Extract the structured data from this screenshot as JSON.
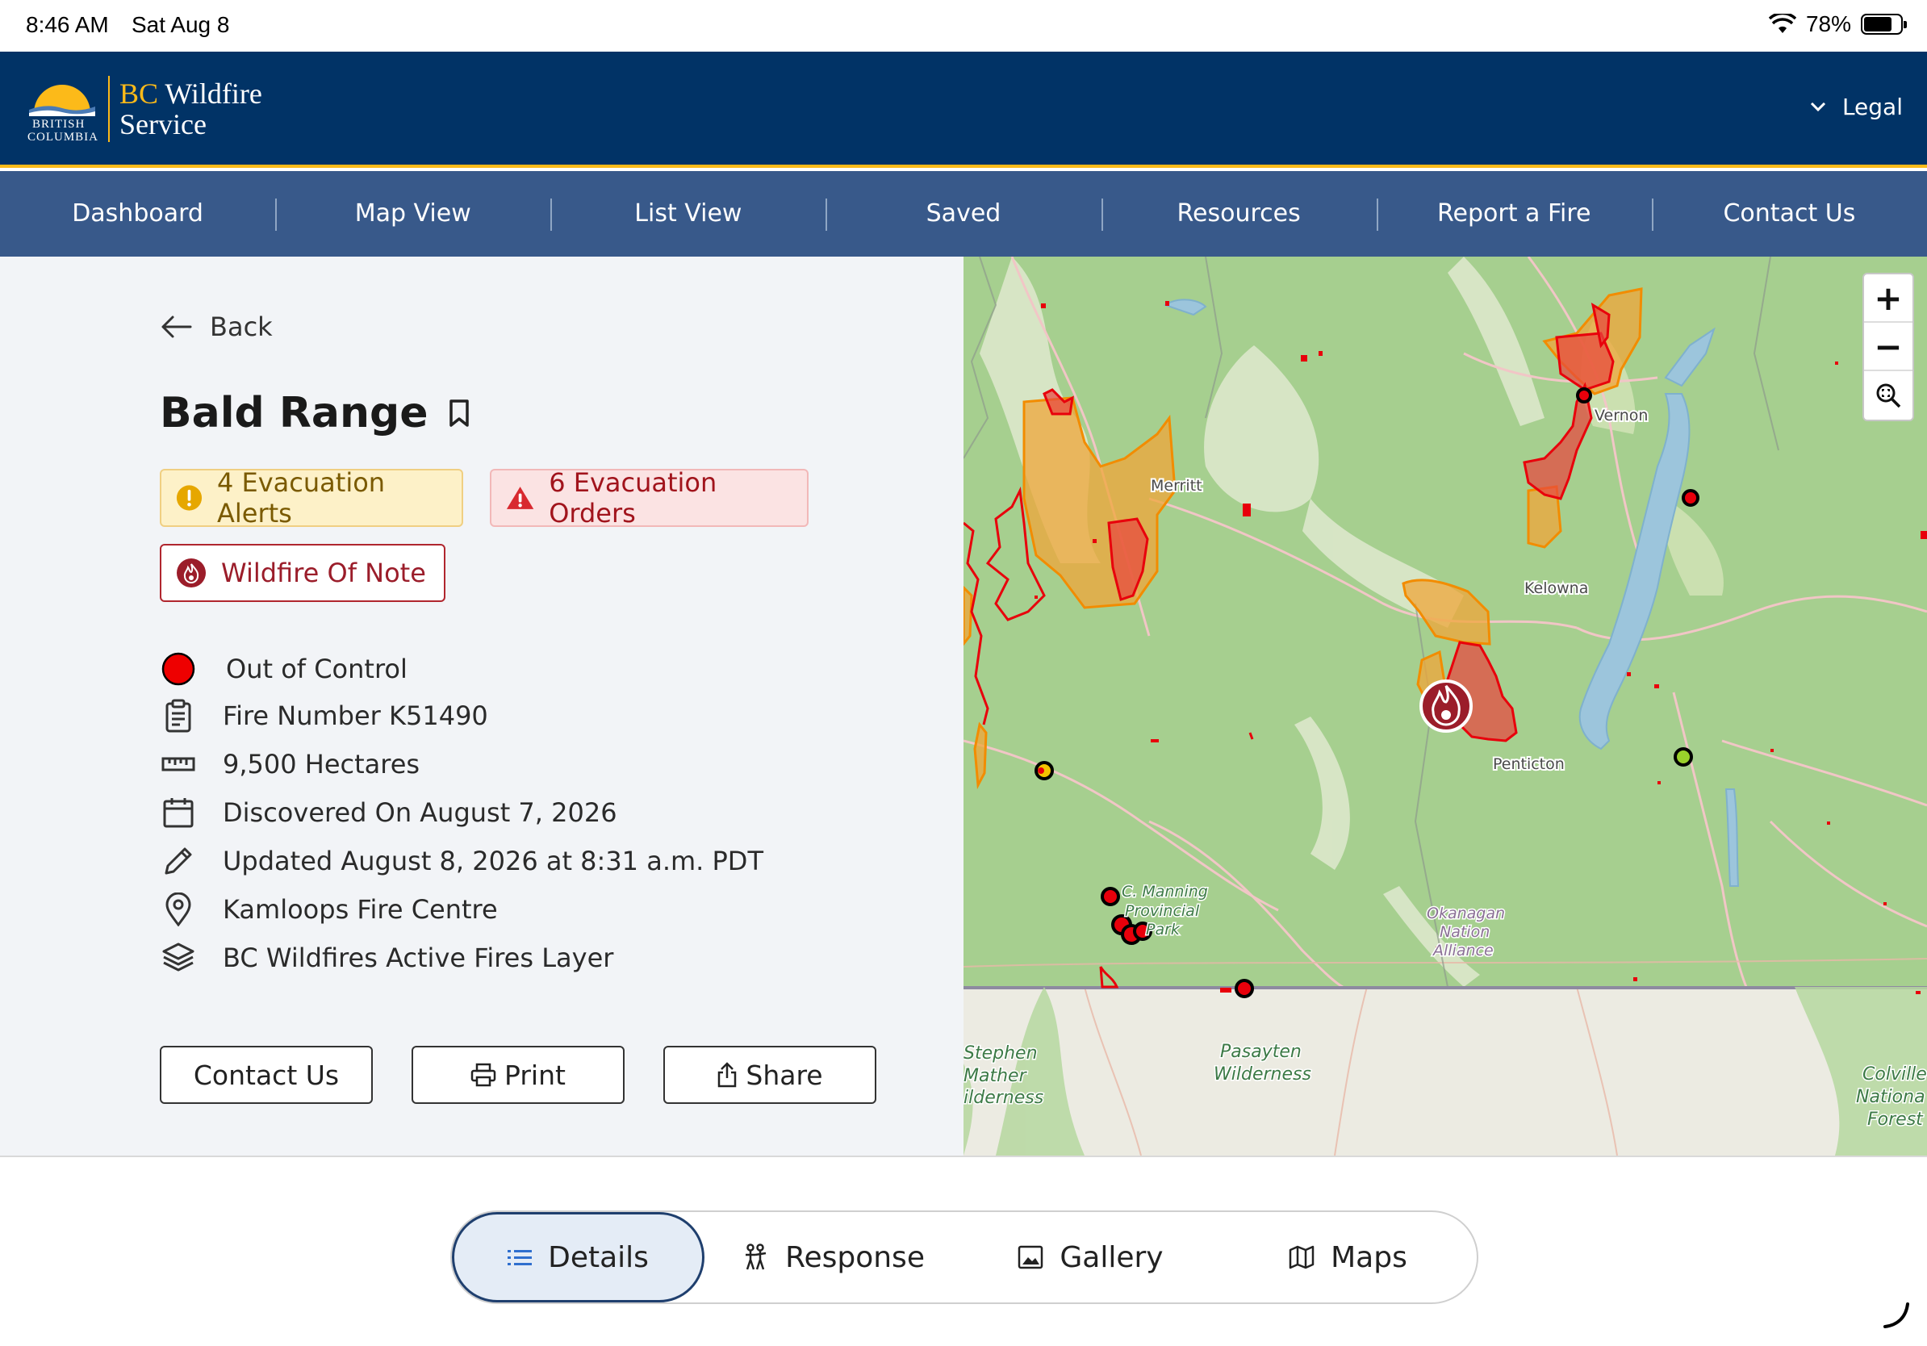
{
  "status": {
    "time": "8:46 AM",
    "date": "Sat Aug 8",
    "battery": "78%"
  },
  "header": {
    "logo_line1": "BRITISH",
    "logo_line2": "COLUMBIA",
    "brand_a": "BC",
    "brand_b": "Wildfire",
    "brand_c": "Service",
    "legal": "Legal"
  },
  "nav": [
    "Dashboard",
    "Map View",
    "List View",
    "Saved",
    "Resources",
    "Report a Fire",
    "Contact Us"
  ],
  "panel": {
    "back": "Back",
    "title": "Bald Range",
    "alerts": "4 Evacuation Alerts",
    "orders": "6 Evacuation Orders",
    "note": "Wildfire Of Note",
    "status": "Out of Control",
    "fire_number": "Fire Number K51490",
    "size": "9,500 Hectares",
    "discovered": "Discovered On August 7, 2026",
    "updated": "Updated August 8, 2026 at 8:31 a.m. PDT",
    "centre": "Kamloops Fire Centre",
    "layer": "BC Wildfires Active Fires Layer",
    "btn_contact": "Contact Us",
    "btn_print": "Print",
    "btn_share": "Share"
  },
  "map": {
    "labels": {
      "merritt": "Merritt",
      "vernon": "Vernon",
      "kelowna": "Kelowna",
      "penticton": "Penticton",
      "manning1": "C. Manning",
      "manning2": "Provincial",
      "manning3": "Park",
      "okanagan1": "Okanagan",
      "okanagan2": "Nation",
      "okanagan3": "Alliance",
      "stephen1": "Stephen",
      "stephen2": "Mather",
      "stephen3": "ilderness",
      "pasayten1": "Pasayten",
      "pasayten2": "Wilderness",
      "colville1": "Colville",
      "colville2": "Nationa",
      "colville3": "Forest"
    },
    "zoom_in": "+",
    "zoom_out": "−"
  },
  "tabs": {
    "details": "Details",
    "response": "Response",
    "gallery": "Gallery",
    "maps": "Maps"
  }
}
